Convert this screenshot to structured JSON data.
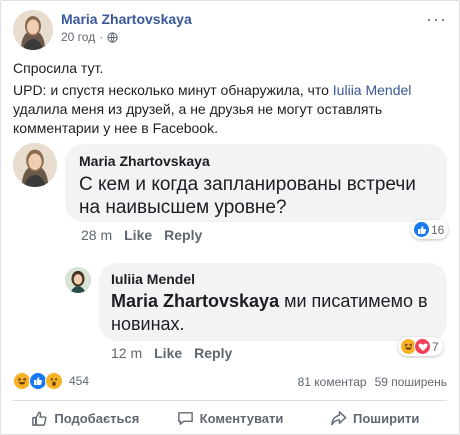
{
  "post": {
    "author": "Maria Zhartovskaya",
    "time": "20 год",
    "privacy_icon": "globe-icon",
    "text_line1": "Спросила тут.",
    "text_part1": "UPD: и спустя несколько минут обнаружила, что ",
    "text_link": "Iuliia Mendel",
    "text_part2": " удалила меня из друзей, а не друзья не могут оставлять комментарии у нее в Facebook."
  },
  "comments": [
    {
      "author": "Maria Zhartovskaya",
      "text": "С кем и когда запланированы встречи на наивысшем уровне?",
      "time": "28 m",
      "like_label": "Like",
      "reply_label": "Reply",
      "reaction_count": "16"
    },
    {
      "author": "Iuliia Mendel",
      "mention": "Maria Zhartovskaya",
      "text": " ми писатимемо в новинах.",
      "time": "12 m",
      "like_label": "Like",
      "reply_label": "Reply",
      "reaction_count": "7"
    }
  ],
  "totals": {
    "reactions": "454",
    "comments": "81 коментар",
    "shares": "59 поширень"
  },
  "actions": {
    "like": "Подобається",
    "comment": "Коментувати",
    "share": "Поширити"
  },
  "colors": {
    "link": "#385898",
    "like_blue": "#1877f2",
    "love_red": "#f33e58",
    "haha_yellow": "#f7b125",
    "text_secondary": "#606770"
  }
}
